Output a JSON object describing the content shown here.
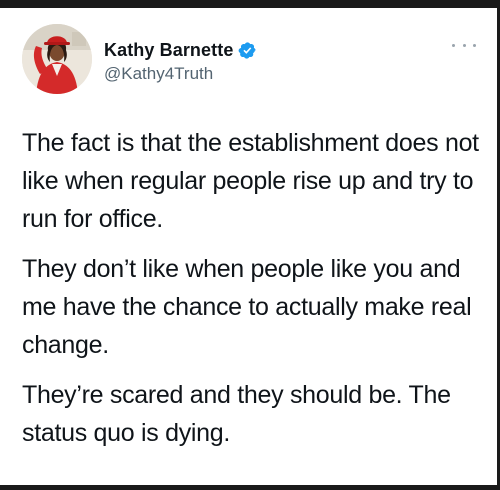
{
  "tweet": {
    "display_name": "Kathy Barnette",
    "handle": "@Kathy4Truth",
    "verified": true,
    "paragraphs": [
      "The fact is that the establishment does not like when regular people rise up and try to run for office.",
      "They don’t like when people like you and me have the chance to actually make real change.",
      "They’re scared and they should be. The status quo is dying."
    ]
  },
  "icons": {
    "verified": "verified-badge-icon",
    "more": "more-options-icon"
  },
  "colors": {
    "verified_blue": "#1d9bf0",
    "handle_gray": "#536471",
    "text": "#0f1419"
  }
}
